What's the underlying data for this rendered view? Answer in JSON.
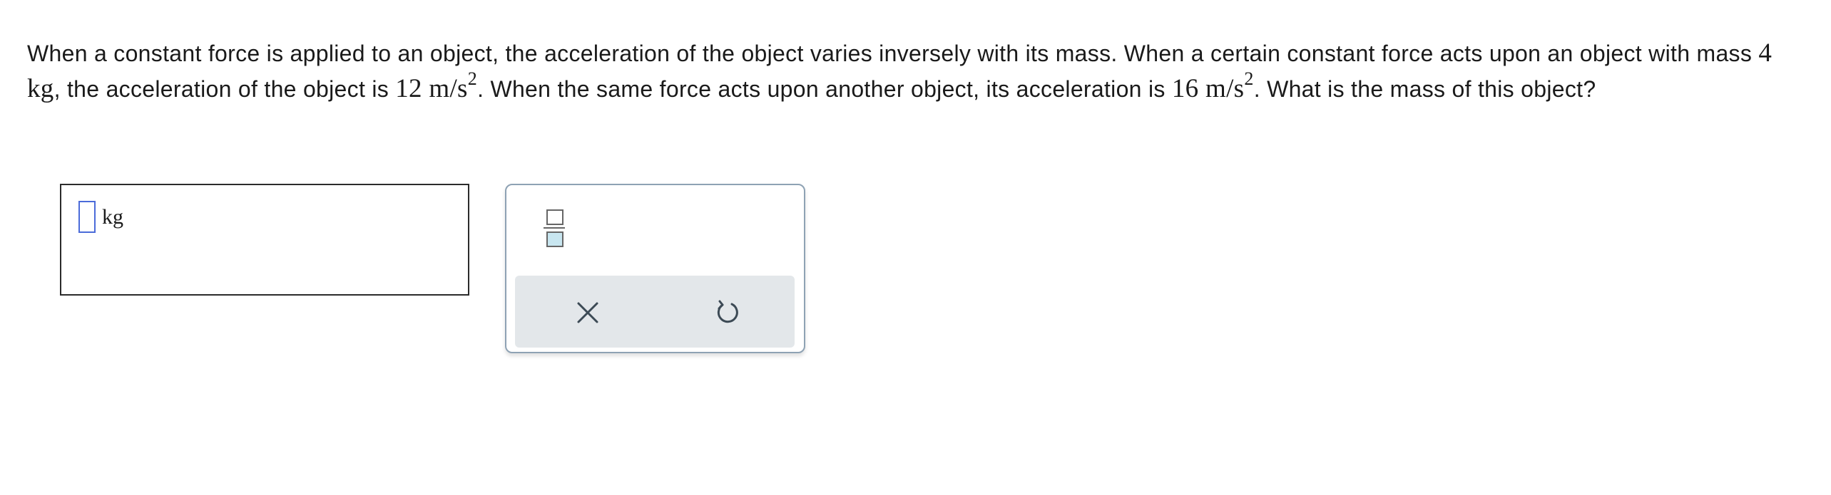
{
  "question": {
    "line1": "When a constant force is applied to an object, the acceleration of the object varies inversely with its mass. When a certain constant force acts upon an object with mass ",
    "mass_value": "4 kg",
    "line2": ", the acceleration of the object is ",
    "accel1_value": "12 m/s",
    "accel1_exp": "2",
    "line3": ". When the same force acts upon another object, its acceleration is ",
    "accel2_value": "16 m/s",
    "accel2_exp": "2",
    "line4": ". What is the mass of this object?"
  },
  "answer": {
    "value": "",
    "unit": "kg"
  },
  "toolbox": {
    "fraction_icon": "fraction-template-icon",
    "clear_icon": "close-icon",
    "reset_icon": "undo-icon"
  },
  "colors": {
    "input_border": "#4b6bd9",
    "toolbox_border": "#8ea2b4",
    "action_bar_bg": "#e3e7ea",
    "fraction_denominator_fill": "#c8e6f0"
  }
}
